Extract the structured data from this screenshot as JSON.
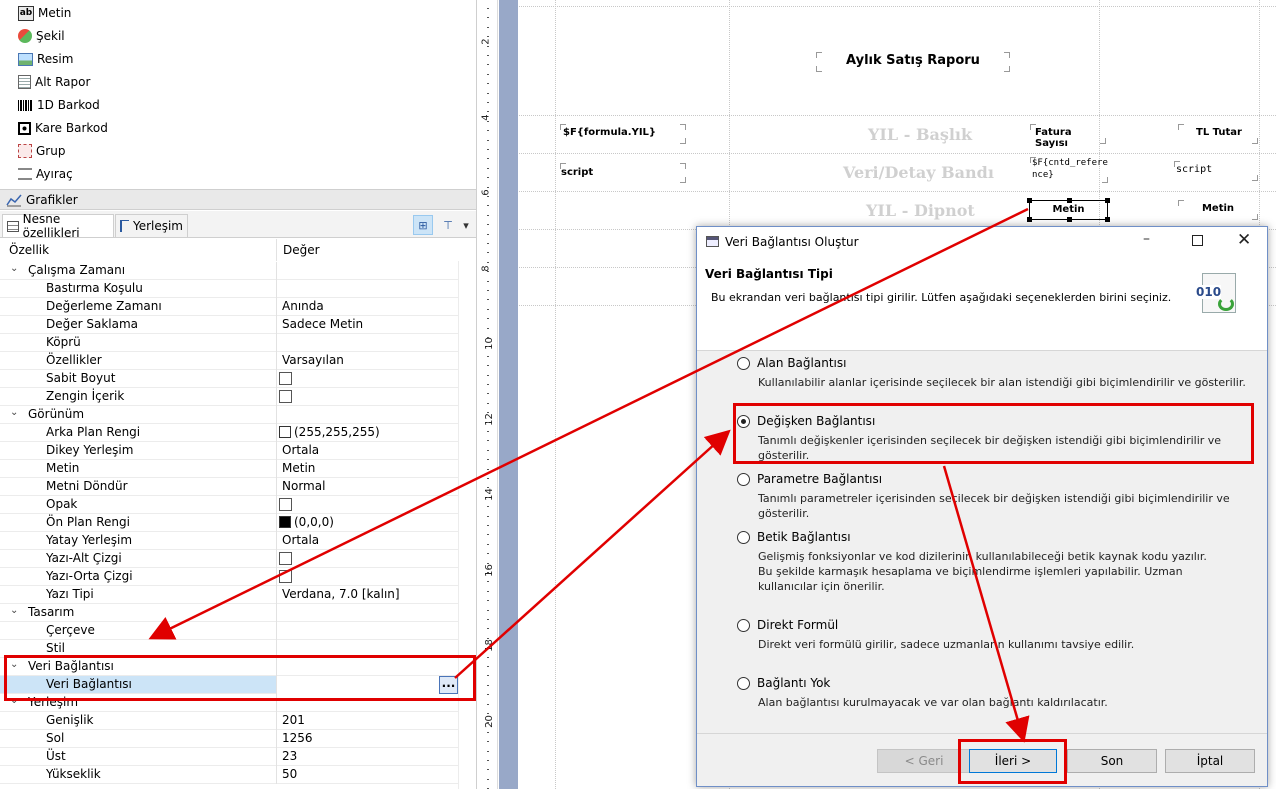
{
  "palette": {
    "items": [
      {
        "label": "Metin",
        "icon": "text-icon"
      },
      {
        "label": "Şekil",
        "icon": "shape-icon"
      },
      {
        "label": "Resim",
        "icon": "image-icon"
      },
      {
        "label": "Alt Rapor",
        "icon": "subreport-icon"
      },
      {
        "label": "1D Barkod",
        "icon": "barcode-icon"
      },
      {
        "label": "Kare Barkod",
        "icon": "qr-code-icon"
      },
      {
        "label": "Grup",
        "icon": "group-icon"
      },
      {
        "label": "Ayıraç",
        "icon": "separator-icon"
      }
    ],
    "section": "Grafikler"
  },
  "tabs": {
    "properties": "Nesne özellikleri",
    "layout": "Yerleşim"
  },
  "prop_table": {
    "col_property": "Özellik",
    "col_value": "Değer",
    "rows": [
      {
        "name": "Çalışma Zamanı",
        "value": "",
        "kind": "category"
      },
      {
        "name": "Bastırma Koşulu",
        "value": "",
        "kind": "text"
      },
      {
        "name": "Değerleme Zamanı",
        "value": "Anında",
        "kind": "text"
      },
      {
        "name": "Değer Saklama",
        "value": "Sadece Metin",
        "kind": "text"
      },
      {
        "name": "Köprü",
        "value": "",
        "kind": "text"
      },
      {
        "name": "Özellikler",
        "value": "Varsayılan",
        "kind": "text"
      },
      {
        "name": "Sabit Boyut",
        "value": "",
        "kind": "checkbox"
      },
      {
        "name": "Zengin İçerik",
        "value": "",
        "kind": "checkbox"
      },
      {
        "name": "Görünüm",
        "value": "",
        "kind": "category"
      },
      {
        "name": "Arka Plan Rengi",
        "value": "(255,255,255)",
        "kind": "color",
        "color": "#ffffff"
      },
      {
        "name": "Dikey Yerleşim",
        "value": "Ortala",
        "kind": "text"
      },
      {
        "name": "Metin",
        "value": "Metin",
        "kind": "text"
      },
      {
        "name": "Metni Döndür",
        "value": "Normal",
        "kind": "text"
      },
      {
        "name": "Opak",
        "value": "",
        "kind": "checkbox"
      },
      {
        "name": "Ön Plan Rengi",
        "value": "(0,0,0)",
        "kind": "color",
        "color": "#000000"
      },
      {
        "name": "Yatay Yerleşim",
        "value": "Ortala",
        "kind": "text"
      },
      {
        "name": "Yazı-Alt Çizgi",
        "value": "",
        "kind": "checkbox"
      },
      {
        "name": "Yazı-Orta Çizgi",
        "value": "",
        "kind": "checkbox"
      },
      {
        "name": "Yazı Tipi",
        "value": "Verdana, 7.0 [kalın]",
        "kind": "text"
      },
      {
        "name": "Tasarım",
        "value": "",
        "kind": "category"
      },
      {
        "name": "Çerçeve",
        "value": "",
        "kind": "text"
      },
      {
        "name": "Stil",
        "value": "",
        "kind": "text"
      },
      {
        "name": "Veri Bağlantısı",
        "value": "",
        "kind": "category"
      },
      {
        "name": "Veri Bağlantısı",
        "value": "",
        "kind": "button",
        "selected": true,
        "button_label": "..."
      },
      {
        "name": "Yerleşim",
        "value": "",
        "kind": "category"
      },
      {
        "name": "Genişlik",
        "value": "201",
        "kind": "text"
      },
      {
        "name": "Sol",
        "value": "1256",
        "kind": "text"
      },
      {
        "name": "Üst",
        "value": "23",
        "kind": "text"
      },
      {
        "name": "Yükseklik",
        "value": "50",
        "kind": "text"
      }
    ]
  },
  "ruler": {
    "labels": [
      "2",
      "4",
      "6",
      "8",
      "10",
      "12",
      "14",
      "16",
      "18",
      "20"
    ]
  },
  "report": {
    "title": "Aylık Satış Raporu",
    "band_labels": {
      "header": "YIL - Başlık",
      "detail": "Veri/Detay Bandı",
      "footer": "YIL - Dipnot"
    },
    "fields": {
      "formula": "$F{formula.YIL}",
      "invoice_count": "Fatura Sayısı",
      "tl_amount": "TL Tutar",
      "script1": "script",
      "ref_line1": "$F{cntd_refere",
      "ref_line2": "nce}",
      "script2": "script",
      "metin_selected": "Metin",
      "metin2": "Metin"
    }
  },
  "dialog": {
    "title": "Veri Bağlantısı Oluştur",
    "heading": "Veri Bağlantısı Tipi",
    "subheading": "Bu ekrandan veri bağlantısı tipi girilir. Lütfen aşağıdaki seçeneklerden birini seçiniz.",
    "header_icon_text": "010",
    "options": [
      {
        "title": "Alan Bağlantısı",
        "desc": [
          "Kullanılabilir alanlar içerisinde seçilecek bir alan istendiği gibi biçimlendirilir ve gösterilir."
        ],
        "selected": false
      },
      {
        "title": "Değişken Bağlantısı",
        "desc": [
          "Tanımlı değişkenler içerisinden seçilecek bir değişken istendiği gibi biçimlendirilir ve gösterilir."
        ],
        "selected": true
      },
      {
        "title": "Parametre Bağlantısı",
        "desc": [
          "Tanımlı parametreler içerisinden seçilecek bir değişken istendiği gibi biçimlendirilir ve gösterilir."
        ],
        "selected": false
      },
      {
        "title": "Betik Bağlantısı",
        "desc": [
          "Gelişmiş fonksiyonlar ve kod dizilerinin kullanılabileceği betik kaynak kodu yazılır.",
          "Bu şekilde karmaşık hesaplama ve biçimlendirme işlemleri yapılabilir. Uzman",
          "kullanıcılar için önerilir."
        ],
        "selected": false
      },
      {
        "title": "Direkt Formül",
        "desc": [
          "Direkt veri formülü girilir, sadece uzmanların kullanımı tavsiye edilir."
        ],
        "selected": false
      },
      {
        "title": "Bağlantı Yok",
        "desc": [
          "Alan bağlantısı kurulmayacak ve var olan bağlantı kaldırılacatır."
        ],
        "selected": false
      }
    ],
    "buttons": {
      "back": "< Geri",
      "next": "İleri >",
      "finish": "Son",
      "cancel": "İptal"
    }
  },
  "colors": {
    "annotation_red": "#e00000",
    "selection_blue": "#cce4f7",
    "margin_strip": "#98a8c8"
  }
}
